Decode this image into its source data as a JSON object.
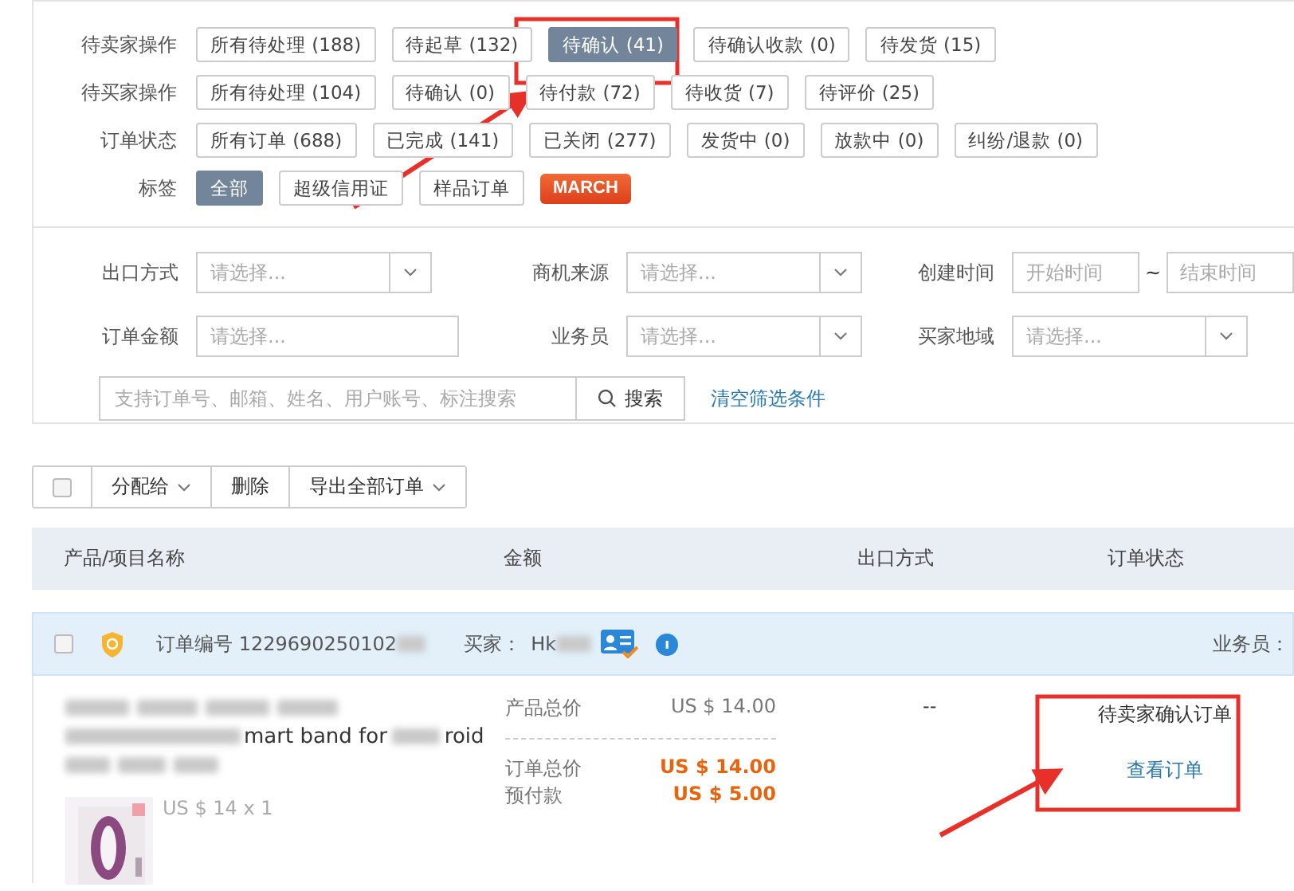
{
  "filter_groups": [
    {
      "label": "待卖家操作",
      "options": [
        {
          "label": "所有待处理 (188)",
          "selected": false
        },
        {
          "label": "待起草 (132)",
          "selected": false
        },
        {
          "label": "待确认 (41)",
          "selected": true
        },
        {
          "label": "待确认收款 (0)",
          "selected": false
        },
        {
          "label": "待发货 (15)",
          "selected": false
        }
      ]
    },
    {
      "label": "待买家操作",
      "options": [
        {
          "label": "所有待处理 (104)",
          "selected": false
        },
        {
          "label": "待确认 (0)",
          "selected": false
        },
        {
          "label": "待付款 (72)",
          "selected": false
        },
        {
          "label": "待收货 (7)",
          "selected": false
        },
        {
          "label": "待评价 (25)",
          "selected": false
        }
      ]
    },
    {
      "label": "订单状态",
      "options": [
        {
          "label": "所有订单 (688)",
          "selected": false
        },
        {
          "label": "已完成 (141)",
          "selected": false
        },
        {
          "label": "已关闭 (277)",
          "selected": false
        },
        {
          "label": "发货中 (0)",
          "selected": false
        },
        {
          "label": "放款中 (0)",
          "selected": false
        },
        {
          "label": "纠纷/退款 (0)",
          "selected": false
        }
      ]
    },
    {
      "label": "标签",
      "options": [
        {
          "label": "全部",
          "selected": true,
          "kind": "tag"
        },
        {
          "label": "超级信用证",
          "selected": false,
          "kind": "tag"
        },
        {
          "label": "样品订单",
          "selected": false,
          "kind": "tag"
        },
        {
          "label": "MARCH",
          "selected": false,
          "kind": "badge"
        }
      ]
    }
  ],
  "filters": [
    {
      "label": "出口方式",
      "kind": "select",
      "placeholder": "请选择..."
    },
    {
      "label": "商机来源",
      "kind": "select",
      "placeholder": "请选择..."
    },
    {
      "label": "创建时间",
      "kind": "date_range",
      "start_placeholder": "开始时间",
      "separator": "~",
      "end_placeholder": "结束时间"
    },
    {
      "label": "订单金额",
      "kind": "input",
      "placeholder": "请选择..."
    },
    {
      "label": "业务员",
      "kind": "select",
      "placeholder": "请选择..."
    },
    {
      "label": "买家地域",
      "kind": "select",
      "placeholder": "请选择..."
    }
  ],
  "search": {
    "placeholder": "支持订单号、邮箱、姓名、用户账号、标注搜索",
    "button": "搜索",
    "clear_link": "清空筛选条件"
  },
  "toolbar": {
    "select_all_checked": false,
    "buttons": [
      {
        "label": "分配给",
        "dropdown": true
      },
      {
        "label": "删除",
        "dropdown": false
      },
      {
        "label": "导出全部订单",
        "dropdown": true
      }
    ]
  },
  "table": {
    "columns": [
      "产品/项目名称",
      "金额",
      "出口方式",
      "订单状态"
    ]
  },
  "orders": [
    {
      "checked": false,
      "order_no": "订单编号 1229690250102",
      "buyer_label": "买家：",
      "buyer": "Hk",
      "salesperson_label": "业务员：",
      "title_fragments": [
        "mart band for",
        "roid"
      ],
      "unit_price": "US $ 14 x 1",
      "amounts": [
        {
          "label": "产品总价",
          "value": "US $ 14.00",
          "kind": "plain"
        },
        {
          "label": "订单总价",
          "value": "US $ 14.00",
          "kind": "highlight"
        },
        {
          "label": "预付款",
          "value": "US $ 5.00",
          "kind": "highlight"
        }
      ],
      "shipping": "--",
      "status": "待卖家确认订单",
      "action": "查看订单"
    }
  ]
}
